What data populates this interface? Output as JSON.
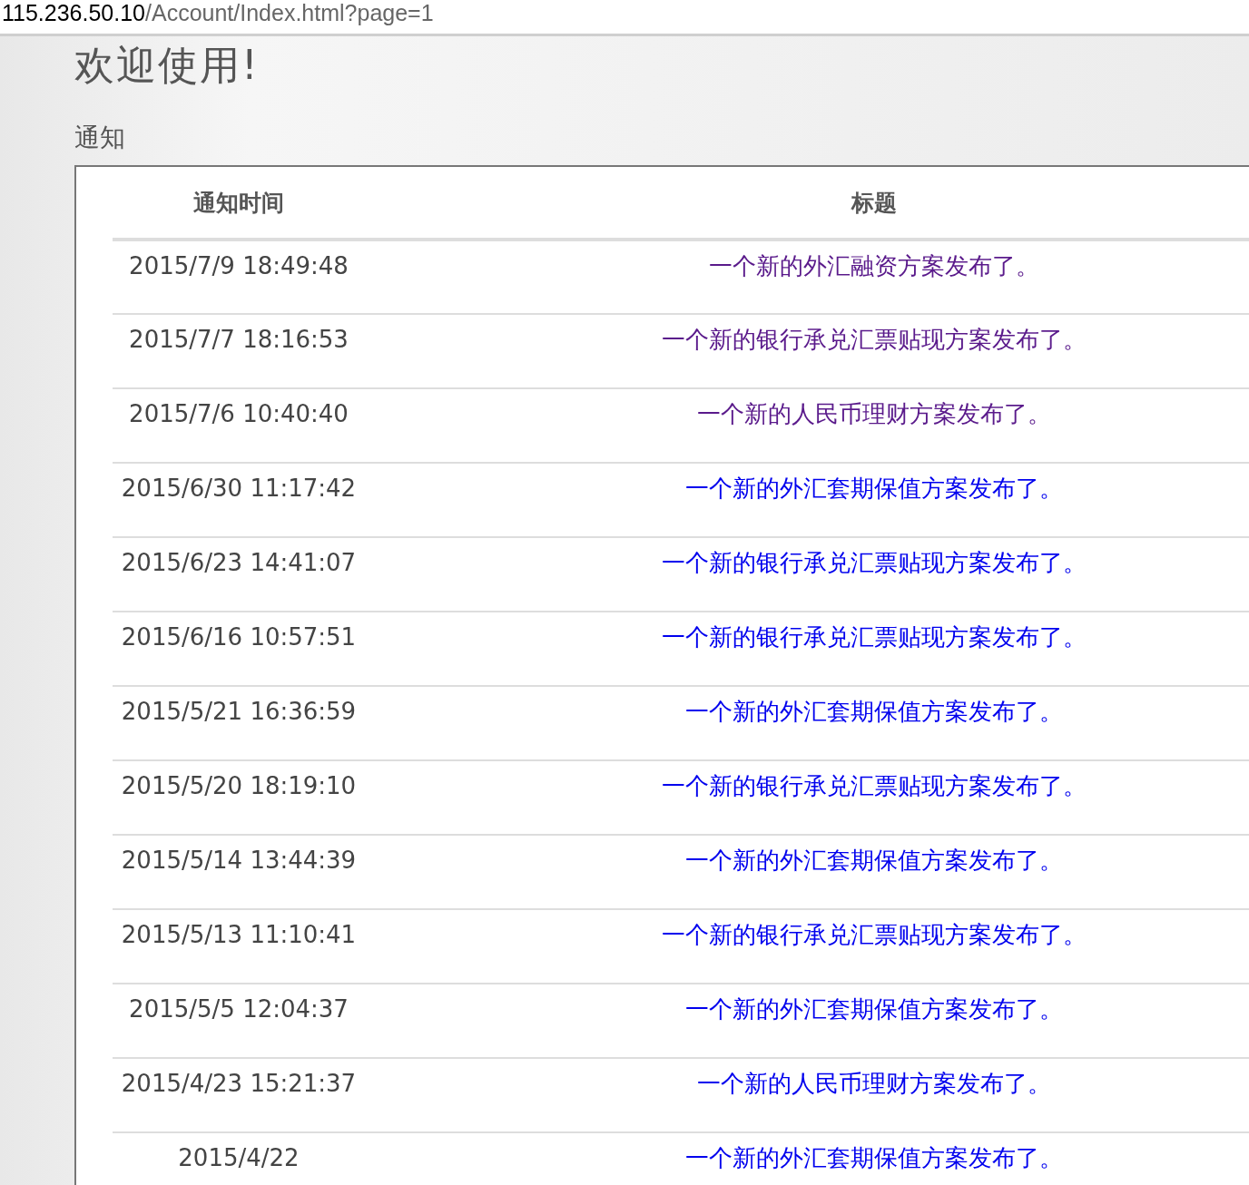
{
  "address_bar": {
    "host": "115.236.50.10",
    "path": "/Account/Index.html?page=1"
  },
  "heading": "欢迎使用!",
  "section_title": "通知",
  "table": {
    "columns": [
      "通知时间",
      "标题"
    ],
    "rows": [
      {
        "time": "2015/7/9 18:49:48",
        "title": "一个新的外汇融资方案发布了。",
        "visited": true
      },
      {
        "time": "2015/7/7 18:16:53",
        "title": "一个新的银行承兑汇票贴现方案发布了。",
        "visited": true
      },
      {
        "time": "2015/7/6 10:40:40",
        "title": "一个新的人民币理财方案发布了。",
        "visited": true
      },
      {
        "time": "2015/6/30 11:17:42",
        "title": "一个新的外汇套期保值方案发布了。",
        "visited": false
      },
      {
        "time": "2015/6/23 14:41:07",
        "title": "一个新的银行承兑汇票贴现方案发布了。",
        "visited": false
      },
      {
        "time": "2015/6/16 10:57:51",
        "title": "一个新的银行承兑汇票贴现方案发布了。",
        "visited": false
      },
      {
        "time": "2015/5/21 16:36:59",
        "title": "一个新的外汇套期保值方案发布了。",
        "visited": false
      },
      {
        "time": "2015/5/20 18:19:10",
        "title": "一个新的银行承兑汇票贴现方案发布了。",
        "visited": false
      },
      {
        "time": "2015/5/14 13:44:39",
        "title": "一个新的外汇套期保值方案发布了。",
        "visited": false
      },
      {
        "time": "2015/5/13 11:10:41",
        "title": "一个新的银行承兑汇票贴现方案发布了。",
        "visited": false
      },
      {
        "time": "2015/5/5 12:04:37",
        "title": "一个新的外汇套期保值方案发布了。",
        "visited": false
      },
      {
        "time": "2015/4/23 15:21:37",
        "title": "一个新的人民币理财方案发布了。",
        "visited": false
      },
      {
        "time": "2015/4/22",
        "title": "一个新的外汇套期保值方案发布了。",
        "visited": false
      }
    ]
  }
}
